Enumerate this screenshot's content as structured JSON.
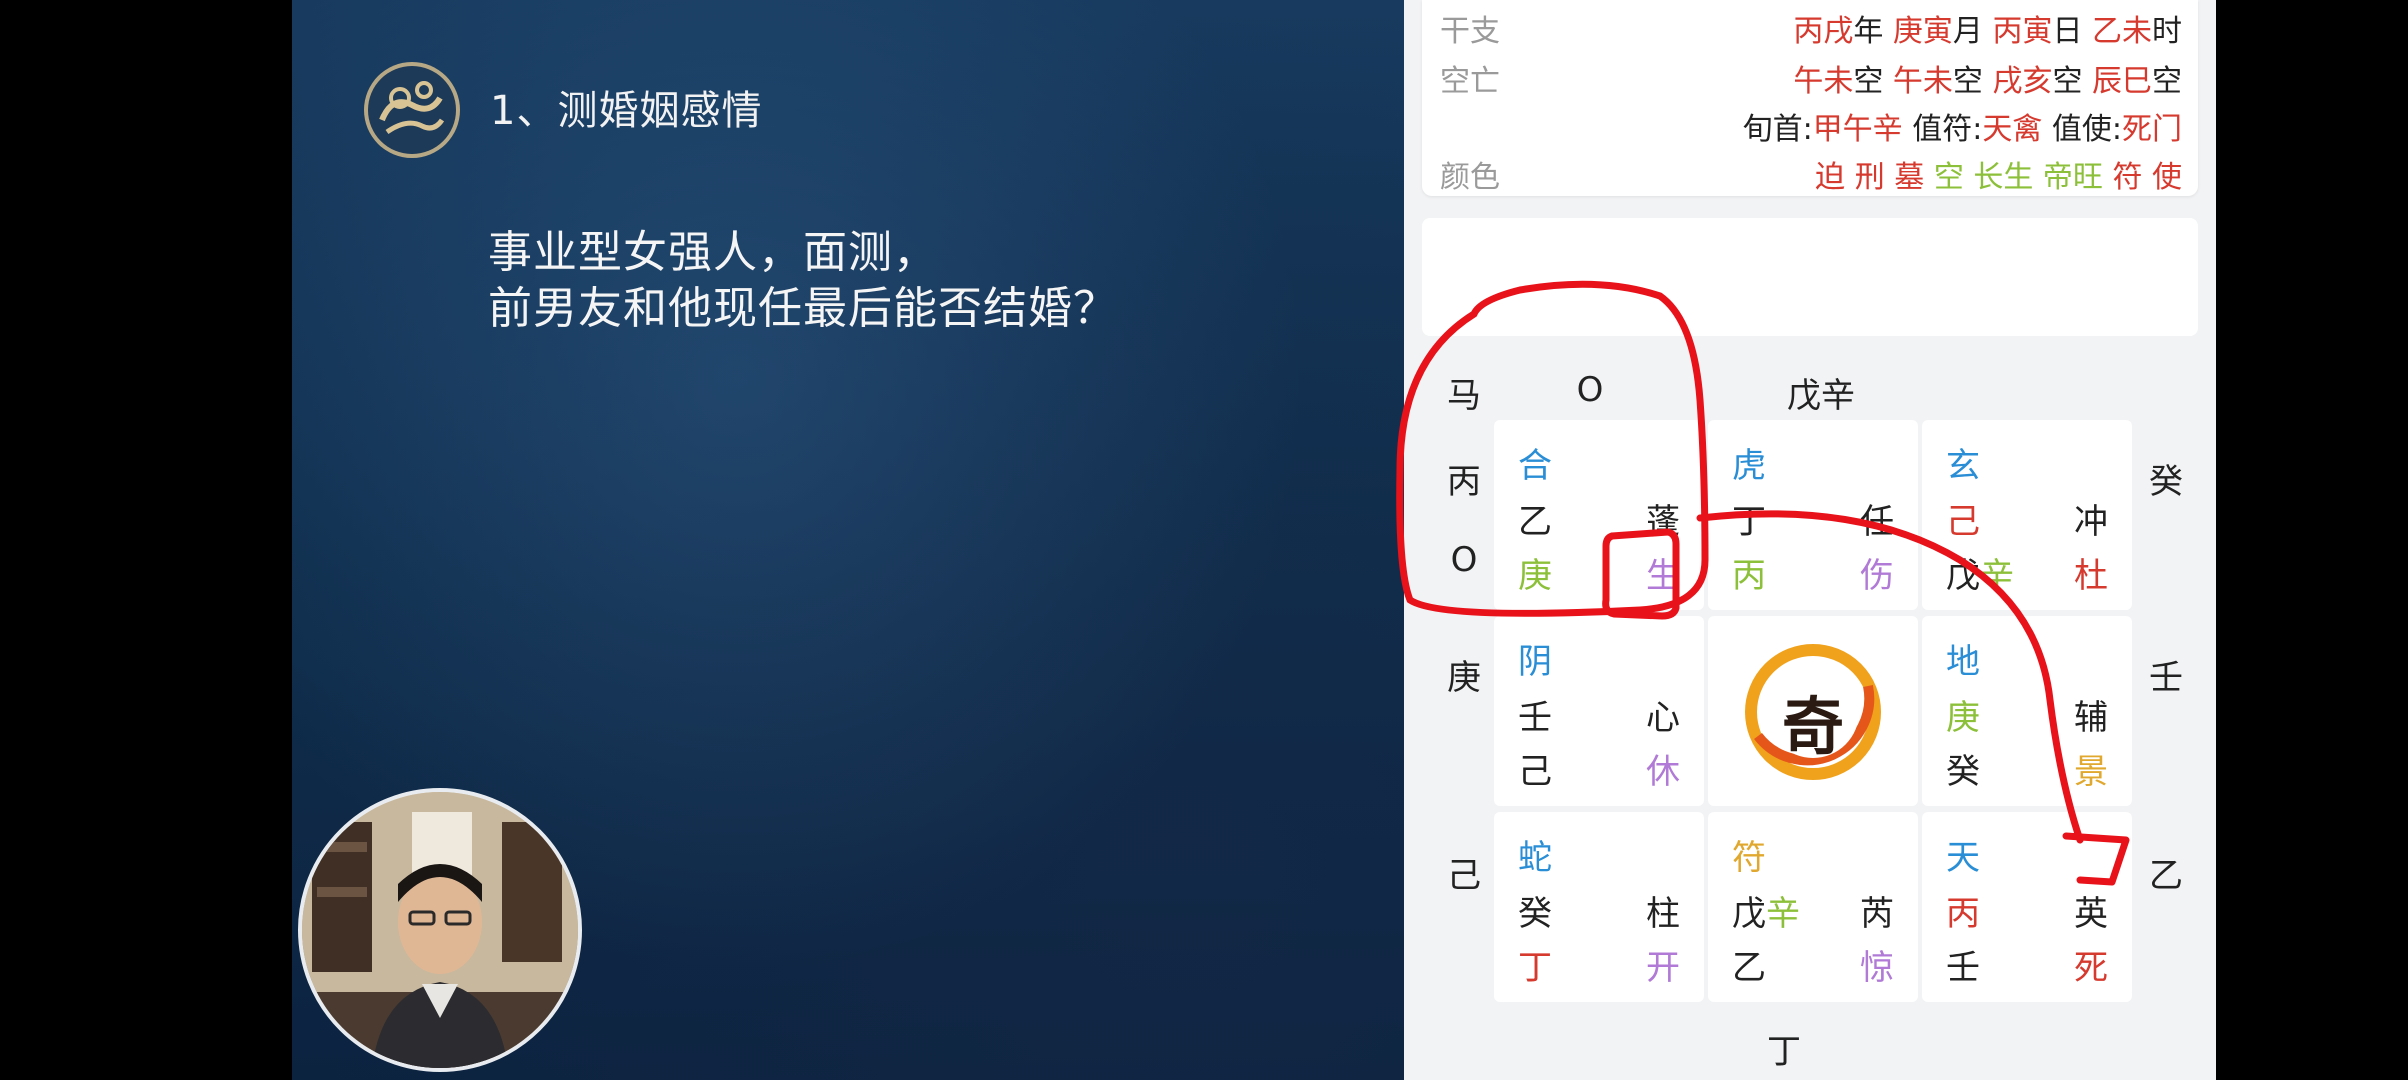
{
  "slide": {
    "heading": "1、测婚姻感情",
    "question_line1": "事业型女强人，面测，",
    "question_line2": "前男友和他现任最后能否结婚？"
  },
  "info": {
    "ganzhi_label": "干支",
    "ganzhi_values": [
      {
        "text": "丙戌",
        "color": "red"
      },
      {
        "text": "年",
        "color": "blk"
      },
      {
        "text": " 庚寅",
        "color": "red"
      },
      {
        "text": "月",
        "color": "blk"
      },
      {
        "text": " 丙寅",
        "color": "red"
      },
      {
        "text": "日",
        "color": "blk"
      },
      {
        "text": " 乙未",
        "color": "red"
      },
      {
        "text": "时",
        "color": "blk"
      }
    ],
    "kongwang_label": "空亡",
    "kongwang_values": [
      {
        "text": "午未",
        "color": "red"
      },
      {
        "text": "空",
        "color": "blk"
      },
      {
        "text": " 午未",
        "color": "red"
      },
      {
        "text": "空",
        "color": "blk"
      },
      {
        "text": " 戌亥",
        "color": "red"
      },
      {
        "text": "空",
        "color": "blk"
      },
      {
        "text": " 辰巳",
        "color": "red"
      },
      {
        "text": "空",
        "color": "blk"
      }
    ],
    "xunshou_values": [
      {
        "text": "旬首:",
        "color": "blk"
      },
      {
        "text": "甲午辛",
        "color": "red"
      },
      {
        "text": "  值符:",
        "color": "blk"
      },
      {
        "text": "天禽",
        "color": "red"
      },
      {
        "text": "  值使:",
        "color": "blk"
      },
      {
        "text": "死门",
        "color": "red"
      }
    ],
    "color_label": "颜色",
    "color_values": [
      {
        "text": "迫 ",
        "color": "red"
      },
      {
        "text": "刑 ",
        "color": "red"
      },
      {
        "text": "墓 ",
        "color": "red"
      },
      {
        "text": "空 ",
        "color": "grn"
      },
      {
        "text": "长生 ",
        "color": "grn"
      },
      {
        "text": "帝旺 ",
        "color": "grn"
      },
      {
        "text": "符 ",
        "color": "red"
      },
      {
        "text": "使",
        "color": "red"
      }
    ]
  },
  "outer": {
    "top_ma": "马",
    "top_o": "O",
    "top_stems": "戊辛",
    "left_1": "丙",
    "left_1_o": "O",
    "left_2": "庚",
    "left_3": "己",
    "right_1": "癸",
    "right_2": "壬",
    "right_3": "乙",
    "bottom": "丁"
  },
  "palaces": [
    {
      "god": "合",
      "tl": "乙",
      "tr": "蓬",
      "bl": "庚",
      "br": "生"
    },
    {
      "god": "虎",
      "tl": "丁",
      "tr": "任",
      "bl": "丙",
      "br": "伤"
    },
    {
      "god": "玄",
      "tl": "己",
      "tr": "冲",
      "bl": "戊",
      "bl2": "辛",
      "br": "杜"
    },
    {
      "god": "阴",
      "tl": "壬",
      "tr": "心",
      "bl": "己",
      "br": "休"
    },
    {
      "god": "地",
      "tl": "庚",
      "tr": "辅",
      "bl": "癸",
      "br": "景"
    },
    {
      "god": "蛇",
      "tl": "癸",
      "tr": "柱",
      "bl": "丁",
      "br": "开"
    },
    {
      "god": "符",
      "tl": "戊",
      "tl2": "辛",
      "tr": "芮",
      "bl": "乙",
      "br": "惊"
    },
    {
      "god": "天",
      "tl": "丙",
      "tr": "英",
      "bl": "壬",
      "br": "死"
    }
  ],
  "center_glyph": "奇",
  "colors": {
    "red": "#d63a2f",
    "green": "#8dc03a",
    "purple": "#b07ad6",
    "blue": "#2a8ed6",
    "gold": "#e0a82e",
    "annotation": "#e8121a"
  }
}
